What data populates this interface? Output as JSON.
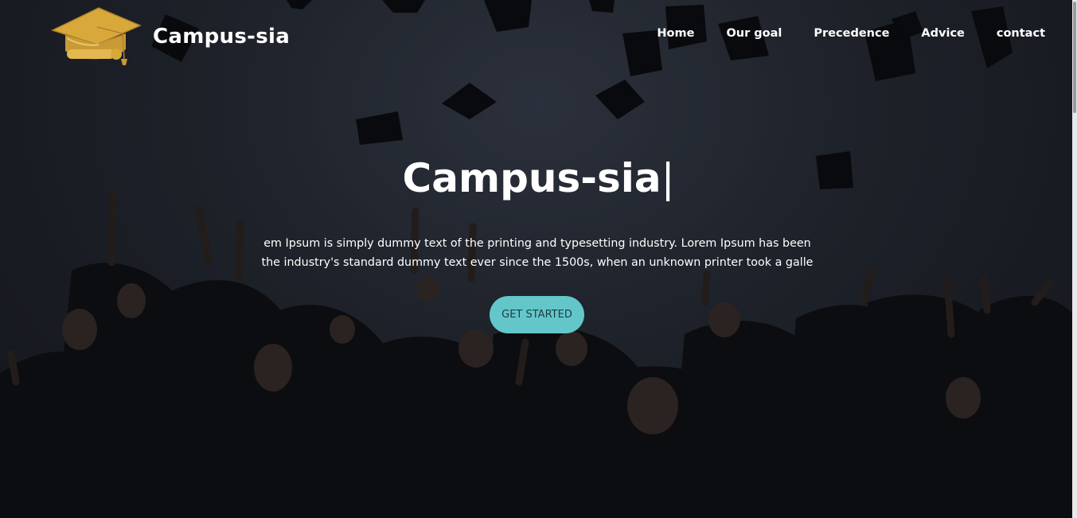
{
  "brand": {
    "name": "Campus-sia",
    "logo_icon": "graduation-cap-icon"
  },
  "nav": [
    {
      "label": "Home"
    },
    {
      "label": "Our goal"
    },
    {
      "label": "Precedence"
    },
    {
      "label": "Advice"
    },
    {
      "label": "contact"
    }
  ],
  "hero": {
    "headline": "Campus-sia",
    "cursor": "|",
    "description_lines": [
      "em Ipsum is simply dummy text of the printing and typesetting industry. Lorem Ipsum has been",
      "the industry's standard dummy text ever since the 1500s, when an unknown printer took a galle"
    ],
    "cta_label": "GET STARTED"
  },
  "colors": {
    "accent": "#63c7c9",
    "text": "#ffffff"
  }
}
